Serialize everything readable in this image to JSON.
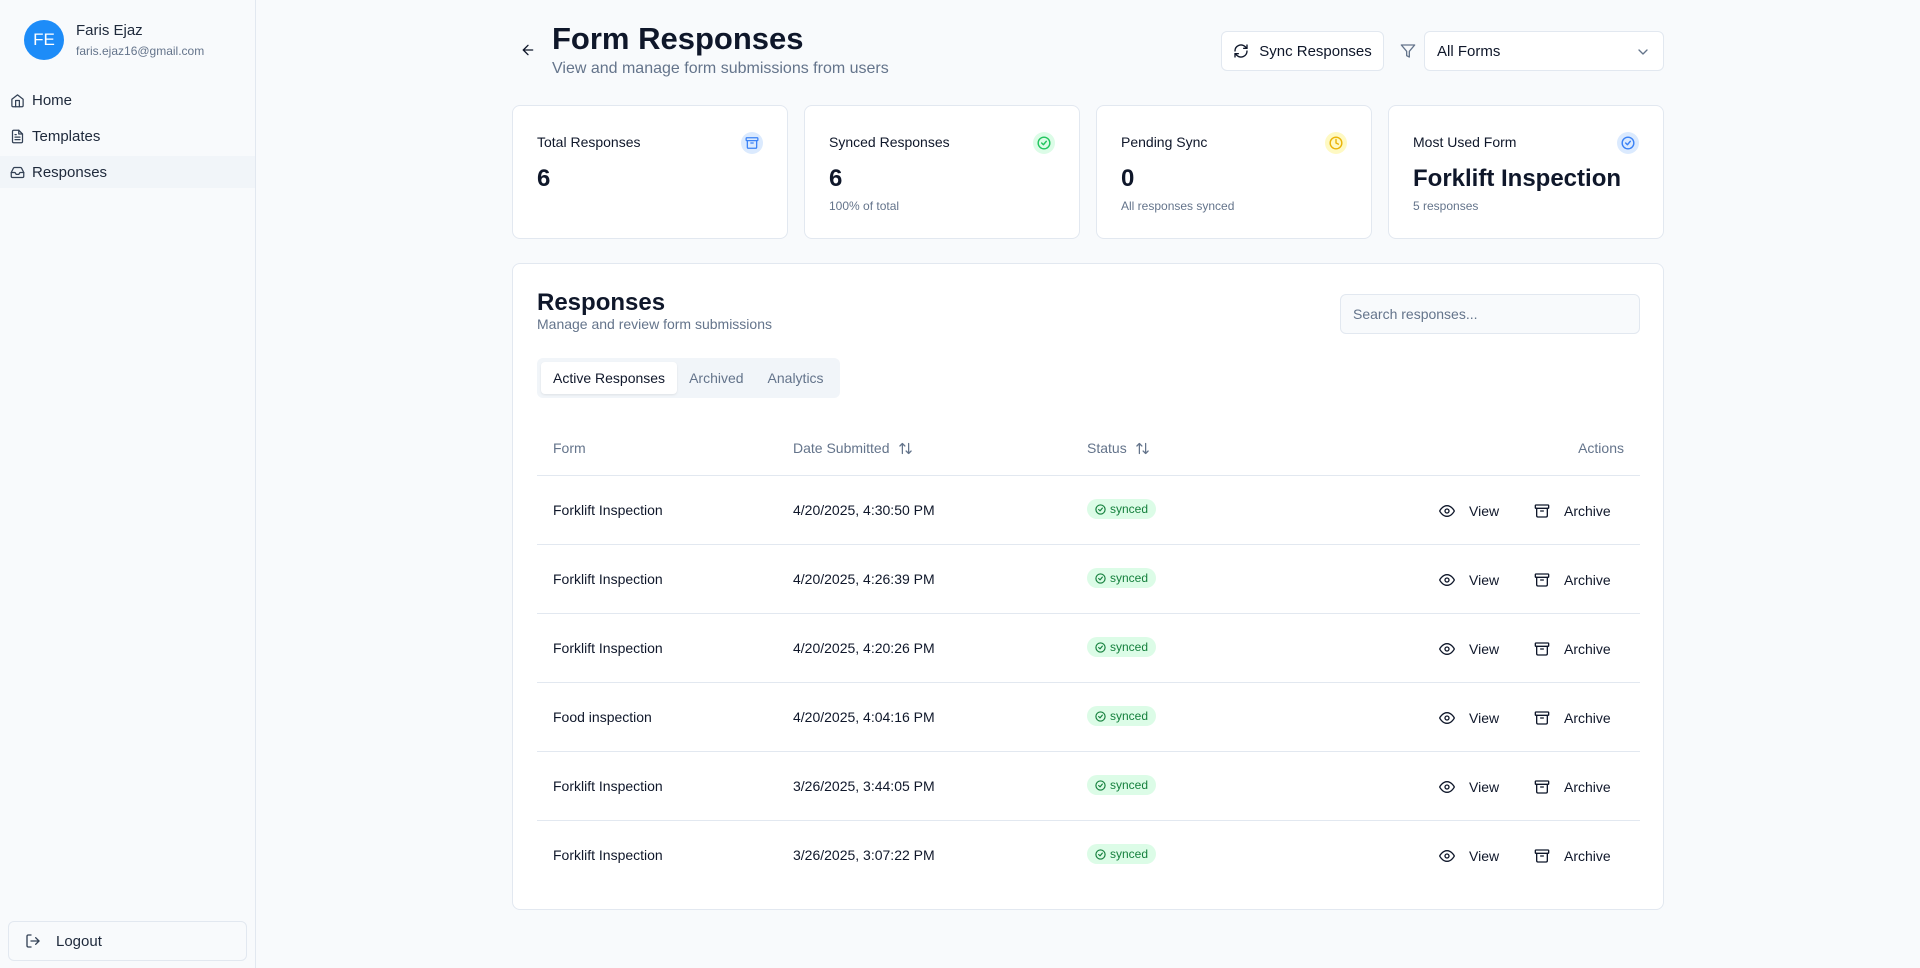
{
  "user": {
    "initials": "FE",
    "name": "Faris Ejaz",
    "email": "faris.ejaz16@gmail.com"
  },
  "nav": [
    {
      "label": "Home",
      "icon": "home-icon"
    },
    {
      "label": "Templates",
      "icon": "file-text-icon"
    },
    {
      "label": "Responses",
      "icon": "inbox-icon",
      "active": true
    }
  ],
  "logout_label": "Logout",
  "header": {
    "title": "Form Responses",
    "subtitle": "View and manage form submissions from users",
    "sync_label": "Sync Responses",
    "form_filter": "All Forms"
  },
  "stats": [
    {
      "label": "Total Responses",
      "value": "6",
      "note": "",
      "icon": "archive-icon",
      "color": "#3b82f6"
    },
    {
      "label": "Synced Responses",
      "value": "6",
      "note": "100% of total",
      "icon": "check-circle-icon",
      "color": "#22c55e"
    },
    {
      "label": "Pending Sync",
      "value": "0",
      "note": "All responses synced",
      "icon": "clock-icon",
      "color": "#eab308"
    },
    {
      "label": "Most Used Form",
      "value": "Forklift Inspection",
      "note": "5 responses",
      "icon": "check-circle-icon",
      "color": "#3b82f6"
    }
  ],
  "panel": {
    "title": "Responses",
    "subtitle": "Manage and review form submissions",
    "search_placeholder": "Search responses...",
    "tabs": [
      "Active Responses",
      "Archived",
      "Analytics"
    ]
  },
  "table": {
    "columns": [
      "Form",
      "Date Submitted",
      "Status",
      "Actions"
    ],
    "view_label": "View",
    "archive_label": "Archive",
    "rows": [
      {
        "form": "Forklift Inspection",
        "date": "4/20/2025, 4:30:50 PM",
        "status": "synced"
      },
      {
        "form": "Forklift Inspection",
        "date": "4/20/2025, 4:26:39 PM",
        "status": "synced"
      },
      {
        "form": "Forklift Inspection",
        "date": "4/20/2025, 4:20:26 PM",
        "status": "synced"
      },
      {
        "form": "Food inspection",
        "date": "4/20/2025, 4:04:16 PM",
        "status": "synced"
      },
      {
        "form": "Forklift Inspection",
        "date": "3/26/2025, 3:44:05 PM",
        "status": "synced"
      },
      {
        "form": "Forklift Inspection",
        "date": "3/26/2025, 3:07:22 PM",
        "status": "synced"
      }
    ]
  }
}
